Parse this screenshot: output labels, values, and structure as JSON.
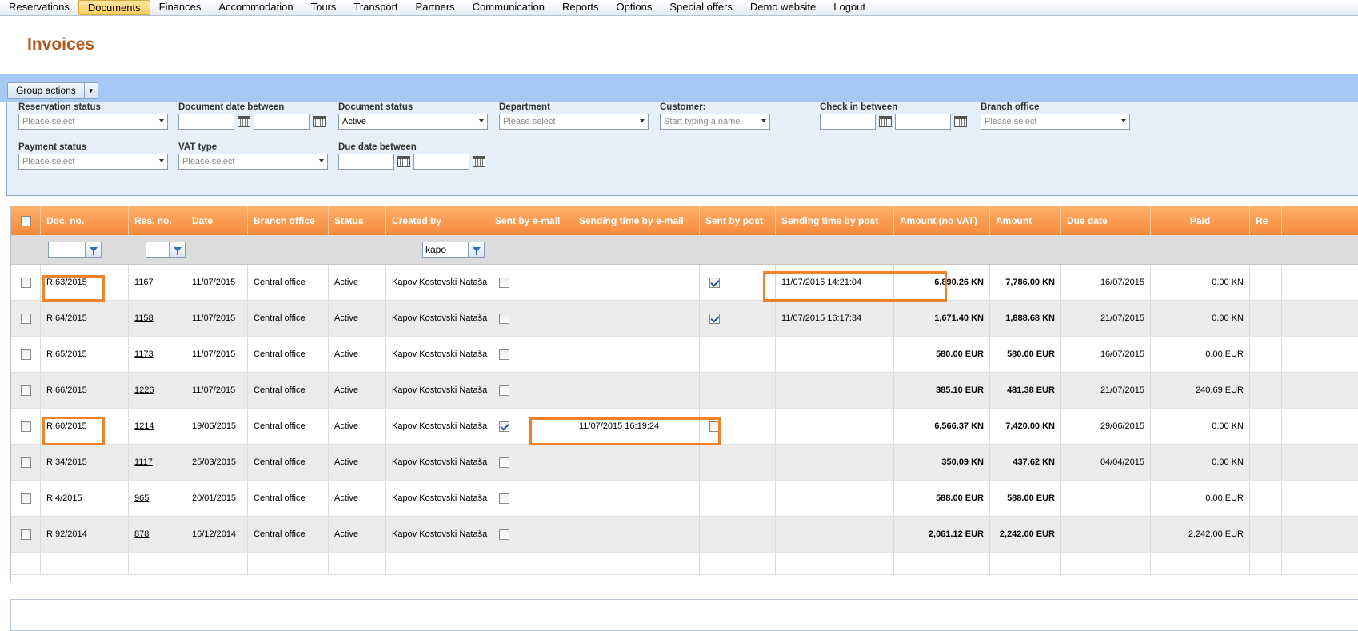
{
  "menu": [
    "Reservations",
    "Documents",
    "Finances",
    "Accommodation",
    "Tours",
    "Transport",
    "Partners",
    "Communication",
    "Reports",
    "Options",
    "Special offers",
    "Demo website",
    "Logout"
  ],
  "active_menu": "Documents",
  "page_title": "Invoices",
  "toolbar": {
    "group_actions": "Group actions"
  },
  "filters": {
    "reservation_status": {
      "label": "Reservation status",
      "value": "Please select"
    },
    "document_date": {
      "label": "Document date between"
    },
    "document_status": {
      "label": "Document status",
      "value": "Active"
    },
    "department": {
      "label": "Department",
      "value": "Please select"
    },
    "customer": {
      "label": "Customer:",
      "placeholder": "Start typing a name"
    },
    "check_in": {
      "label": "Check in between"
    },
    "branch_office": {
      "label": "Branch office",
      "value": "Please select"
    },
    "payment_status": {
      "label": "Payment status",
      "value": "Please select"
    },
    "vat_type": {
      "label": "VAT type",
      "value": "Please select"
    },
    "due_date": {
      "label": "Due date between"
    }
  },
  "columns": [
    "Doc. no.",
    "Res. no.",
    "Date",
    "Branch office",
    "Status",
    "Created by",
    "Sent by e-mail",
    "Sending time by e-mail",
    "Sent by post",
    "Sending time by post",
    "Amount (no VAT)",
    "Amount",
    "Due date",
    "Paid",
    "Re"
  ],
  "column_filters": {
    "doc_no": "",
    "res_no": "",
    "created_by": "kapo"
  },
  "rows": [
    {
      "doc_no": "R 63/2015",
      "res_no": "1167",
      "date": "11/07/2015",
      "branch": "Central office",
      "status": "Active",
      "created_by": "Kapov Kostovski Nataša",
      "sent_email": false,
      "email_time": "",
      "sent_post": true,
      "post_time": "11/07/2015 14:21:04",
      "amount_no_vat": "6,890.26 KN",
      "amount": "7,786.00 KN",
      "due_date": "16/07/2015",
      "paid": "0.00 KN"
    },
    {
      "doc_no": "R 64/2015",
      "res_no": "1158",
      "date": "11/07/2015",
      "branch": "Central office",
      "status": "Active",
      "created_by": "Kapov Kostovski Nataša",
      "sent_email": false,
      "email_time": "",
      "sent_post": true,
      "post_time": "11/07/2015 16:17:34",
      "amount_no_vat": "1,671.40 KN",
      "amount": "1,888.68 KN",
      "due_date": "21/07/2015",
      "paid": "0.00 KN"
    },
    {
      "doc_no": "R 65/2015",
      "res_no": "1173",
      "date": "11/07/2015",
      "branch": "Central office",
      "status": "Active",
      "created_by": "Kapov Kostovski Nataša",
      "sent_email": false,
      "email_time": "",
      "sent_post": null,
      "post_time": "",
      "amount_no_vat": "580.00 EUR",
      "amount": "580.00 EUR",
      "due_date": "16/07/2015",
      "paid": "0.00 EUR"
    },
    {
      "doc_no": "R 66/2015",
      "res_no": "1226",
      "date": "11/07/2015",
      "branch": "Central office",
      "status": "Active",
      "created_by": "Kapov Kostovski Nataša",
      "sent_email": false,
      "email_time": "",
      "sent_post": null,
      "post_time": "",
      "amount_no_vat": "385.10 EUR",
      "amount": "481.38 EUR",
      "due_date": "21/07/2015",
      "paid": "240.69 EUR"
    },
    {
      "doc_no": "R 60/2015",
      "res_no": "1214",
      "date": "19/06/2015",
      "branch": "Central office",
      "status": "Active",
      "created_by": "Kapov Kostovski Nataša",
      "sent_email": true,
      "email_time": "11/07/2015 16:19:24",
      "sent_post": false,
      "post_time": "",
      "amount_no_vat": "6,566.37 KN",
      "amount": "7,420.00 KN",
      "due_date": "29/06/2015",
      "paid": "0.00 KN"
    },
    {
      "doc_no": "R 34/2015",
      "res_no": "1117",
      "date": "25/03/2015",
      "branch": "Central office",
      "status": "Active",
      "created_by": "Kapov Kostovski Nataša",
      "sent_email": false,
      "email_time": "",
      "sent_post": null,
      "post_time": "",
      "amount_no_vat": "350.09 KN",
      "amount": "437.62 KN",
      "due_date": "04/04/2015",
      "paid": "0.00 KN"
    },
    {
      "doc_no": "R 4/2015",
      "res_no": "965",
      "date": "20/01/2015",
      "branch": "Central office",
      "status": "Active",
      "created_by": "Kapov Kostovski Nataša",
      "sent_email": false,
      "email_time": "",
      "sent_post": null,
      "post_time": "",
      "amount_no_vat": "588.00 EUR",
      "amount": "588.00 EUR",
      "due_date": "",
      "paid": "0.00 EUR"
    },
    {
      "doc_no": "R 92/2014",
      "res_no": "878",
      "date": "16/12/2014",
      "branch": "Central office",
      "status": "Active",
      "created_by": "Kapov Kostovski Nataša",
      "sent_email": false,
      "email_time": "",
      "sent_post": null,
      "post_time": "",
      "amount_no_vat": "2,061.12 EUR",
      "amount": "2,242.00 EUR",
      "due_date": "",
      "paid": "2,242.00 EUR"
    }
  ],
  "colors": {
    "header_orange": "#f8893a",
    "highlight": "#f0822e",
    "title": "#b05a20",
    "toolbar_blue": "#a6c9f4"
  }
}
